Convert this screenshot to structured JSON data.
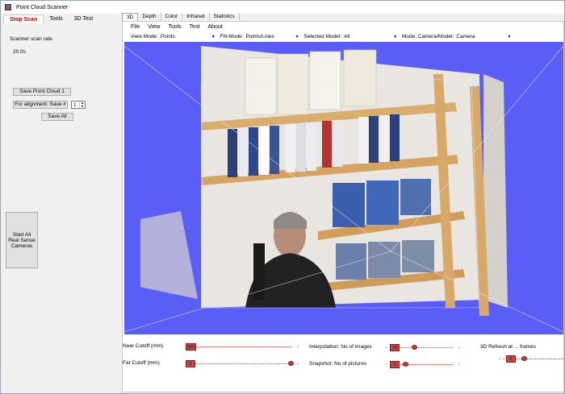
{
  "window": {
    "title": "Point Cloud Scanner"
  },
  "left": {
    "tabs": [
      {
        "label": "Stop Scan",
        "active": true
      },
      {
        "label": "Tools",
        "active": false
      },
      {
        "label": "3D Test",
        "active": false
      }
    ],
    "scan_rate_label": "Scanner scan rate",
    "scan_rate_value": "20 f/s",
    "save_point_cloud_label": "Save Point Cloud 1",
    "for_alignment_label": "For alignment: Save #",
    "alignment_number": "1",
    "save_all_label": "Save All",
    "start_all_label": "Start All Real Sense Cameras"
  },
  "right": {
    "tabs": [
      {
        "label": "3D",
        "active": true
      },
      {
        "label": "Depth",
        "active": false
      },
      {
        "label": "Color",
        "active": false
      },
      {
        "label": "Infrared",
        "active": false
      },
      {
        "label": "Statistics",
        "active": false
      }
    ],
    "menu": [
      "File",
      "View",
      "Tools",
      "Test",
      "About"
    ],
    "toolbar": {
      "view_mode_label": "View Mode:",
      "view_mode_value": "Points",
      "fill_mode_label": "Fill-Mode:",
      "fill_mode_value": "Points/Lines",
      "selected_model_label": "Selected Model:",
      "selected_model_value": "All",
      "mode_label": "Mode: Camera/Model:",
      "mode_value": "Camera"
    },
    "sliders": {
      "near_cutoff": {
        "label": "Near Cutoff (mm)",
        "value": "500",
        "position": 0.05
      },
      "far_cutoff": {
        "label": "Far Cutoff (mm)",
        "value": "2",
        "position": 0.97
      },
      "interpolation": {
        "label": "Interpolation: No of images",
        "value": "10",
        "position": 0.35
      },
      "snapshot": {
        "label": "Snapshot: No of pictures",
        "value": "5",
        "position": 0.2
      },
      "refresh": {
        "label": "3D Refresh at ... frames",
        "value": "5",
        "position": 0.35
      }
    }
  },
  "colors": {
    "view_background": "#5b5df7",
    "active_tab_text": "#c00000",
    "slider_value": "#c84848"
  },
  "icons": {
    "app": "point-cloud-app-icon",
    "dropdown": "dropdown-arrow-icon"
  }
}
